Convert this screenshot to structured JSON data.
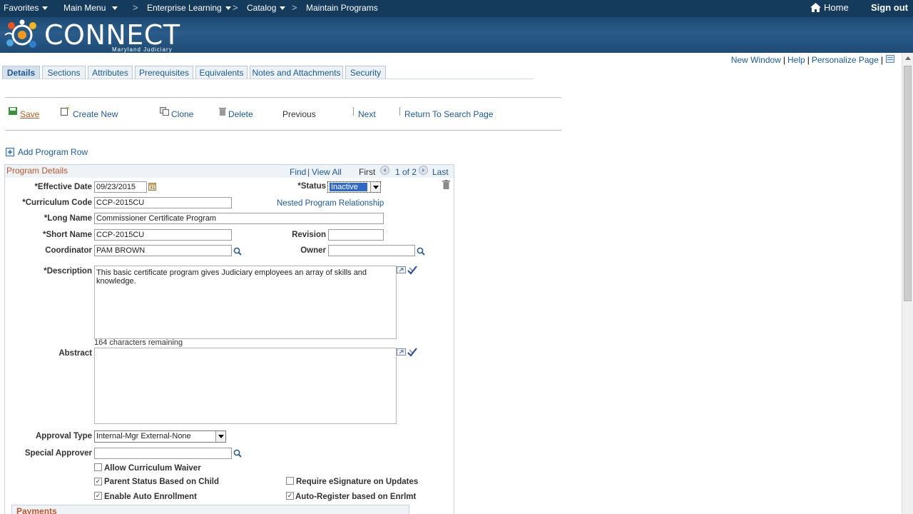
{
  "topnav": {
    "favorites": "Favorites",
    "main_menu": "Main Menu",
    "enterprise_learning": "Enterprise Learning",
    "catalog": "Catalog",
    "maintain_programs": "Maintain Programs",
    "separator": ">",
    "home": "Home",
    "sign_out": "Sign out"
  },
  "banner": {
    "logo_text": "CONNECT",
    "logo_subtitle": "Maryland Judiciary"
  },
  "header_links": {
    "new_window": "New Window",
    "help": "Help",
    "personalize_page": "Personalize Page",
    "divider": "|"
  },
  "tabs": [
    {
      "label": "Details",
      "active": true
    },
    {
      "label": "Sections"
    },
    {
      "label": "Attributes"
    },
    {
      "label": "Prerequisites"
    },
    {
      "label": "Equivalents"
    },
    {
      "label": "Notes and Attachments"
    },
    {
      "label": "Security"
    }
  ],
  "toolbar": {
    "save": "Save",
    "create_new": "Create New",
    "clone": "Clone",
    "delete": "Delete",
    "previous": "Previous",
    "next": "Next",
    "return_to_search": "Return To Search Page"
  },
  "add_program_row": "Add Program Row",
  "program_details": {
    "title": "Program Details",
    "find": "Find",
    "view_all": "View All",
    "divider": "|",
    "first": "First",
    "pagination": "1 of 2",
    "last": "Last",
    "effective_date_label": "*Effective Date",
    "effective_date": "09/23/2015",
    "status_label": "*Status",
    "status": "Inactive",
    "curriculum_code_label": "*Curriculum Code",
    "curriculum_code": "CCP-2015CU",
    "nested_program_link": "Nested Program Relationship",
    "long_name_label": "*Long Name",
    "long_name": "Commissioner Certificate Program",
    "short_name_label": "*Short Name",
    "short_name": "CCP-2015CU",
    "revision_label": "Revision",
    "revision": "",
    "coordinator_label": "Coordinator",
    "coordinator": "PAM BROWN",
    "owner_label": "Owner",
    "owner": "",
    "description_label": "*Description",
    "description": "This basic certificate program gives Judiciary employees an array of skills and knowledge.",
    "chars_remaining": "164 characters remaining",
    "abstract_label": "Abstract",
    "abstract": "",
    "approval_type_label": "Approval Type",
    "approval_type": "Internal-Mgr External-None",
    "special_approver_label": "Special Approver",
    "special_approver": "",
    "allow_curriculum_waiver": {
      "label": "Allow Curriculum Waiver",
      "checked": false
    },
    "parent_status_based_on_child": {
      "label": "Parent Status Based on Child",
      "checked": true
    },
    "require_esignature": {
      "label": "Require eSignature on Updates",
      "checked": false
    },
    "enable_auto_enrollment": {
      "label": "Enable Auto Enrollment",
      "checked": true
    },
    "auto_register_enrlmt": {
      "label": "Auto-Register based on Enrlmt",
      "checked": true
    }
  },
  "payments": {
    "title": "Payments"
  },
  "colors": {
    "topnav_bg": "#143a5c",
    "banner_bg": "#2a5c8a",
    "link": "#1d5a92",
    "group_title": "#c0552a"
  }
}
